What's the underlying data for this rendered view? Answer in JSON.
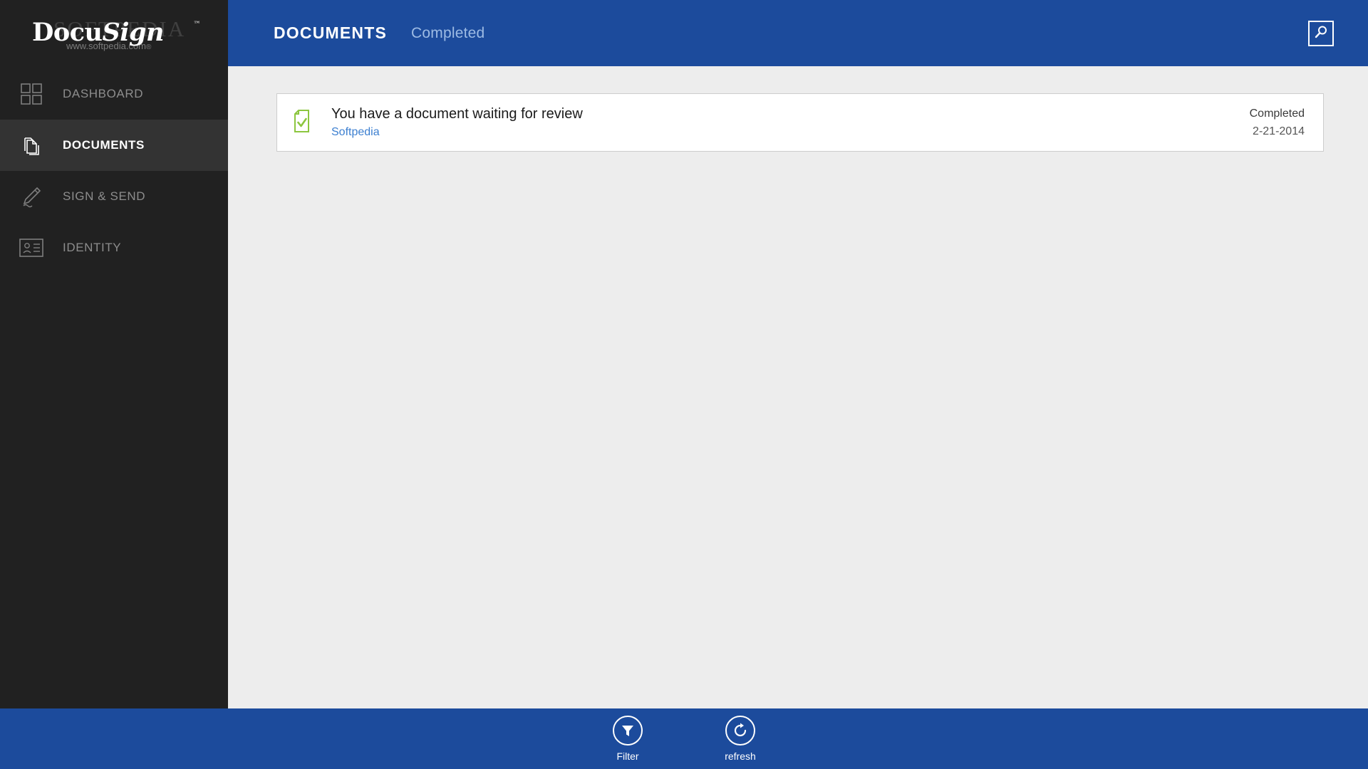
{
  "sidebar": {
    "logo": {
      "text_primary": "Docu",
      "text_secondary": "Sign",
      "trademark": "™",
      "watermark_big": "SOFTPEDIA",
      "watermark_url": "www.softpedia.com",
      "watermark_reg": "®"
    },
    "items": [
      {
        "label": "DASHBOARD",
        "icon": "grid-icon",
        "active": false
      },
      {
        "label": "DOCUMENTS",
        "icon": "documents-stack-icon",
        "active": true
      },
      {
        "label": "SIGN & SEND",
        "icon": "pen-signature-icon",
        "active": false
      },
      {
        "label": "IDENTITY",
        "icon": "id-card-icon",
        "active": false
      }
    ]
  },
  "header": {
    "title": "DOCUMENTS",
    "subtitle": "Completed",
    "search_icon": "search-icon"
  },
  "content": {
    "documents": [
      {
        "icon": "document-check-icon",
        "title": "You have a document waiting for review",
        "sender": "Softpedia",
        "status": "Completed",
        "date": "2-21-2014"
      }
    ]
  },
  "appbar": {
    "buttons": [
      {
        "label": "Filter",
        "icon": "funnel-icon"
      },
      {
        "label": "refresh",
        "icon": "refresh-icon"
      }
    ]
  },
  "colors": {
    "brand_blue": "#1c4b9c",
    "sidebar_dark": "#212121",
    "sidebar_active": "#333333",
    "content_bg": "#ededed",
    "accent_green": "#8cc63f",
    "link_blue": "#3c7fd0",
    "subtitle_blue": "#9dbbe4"
  }
}
